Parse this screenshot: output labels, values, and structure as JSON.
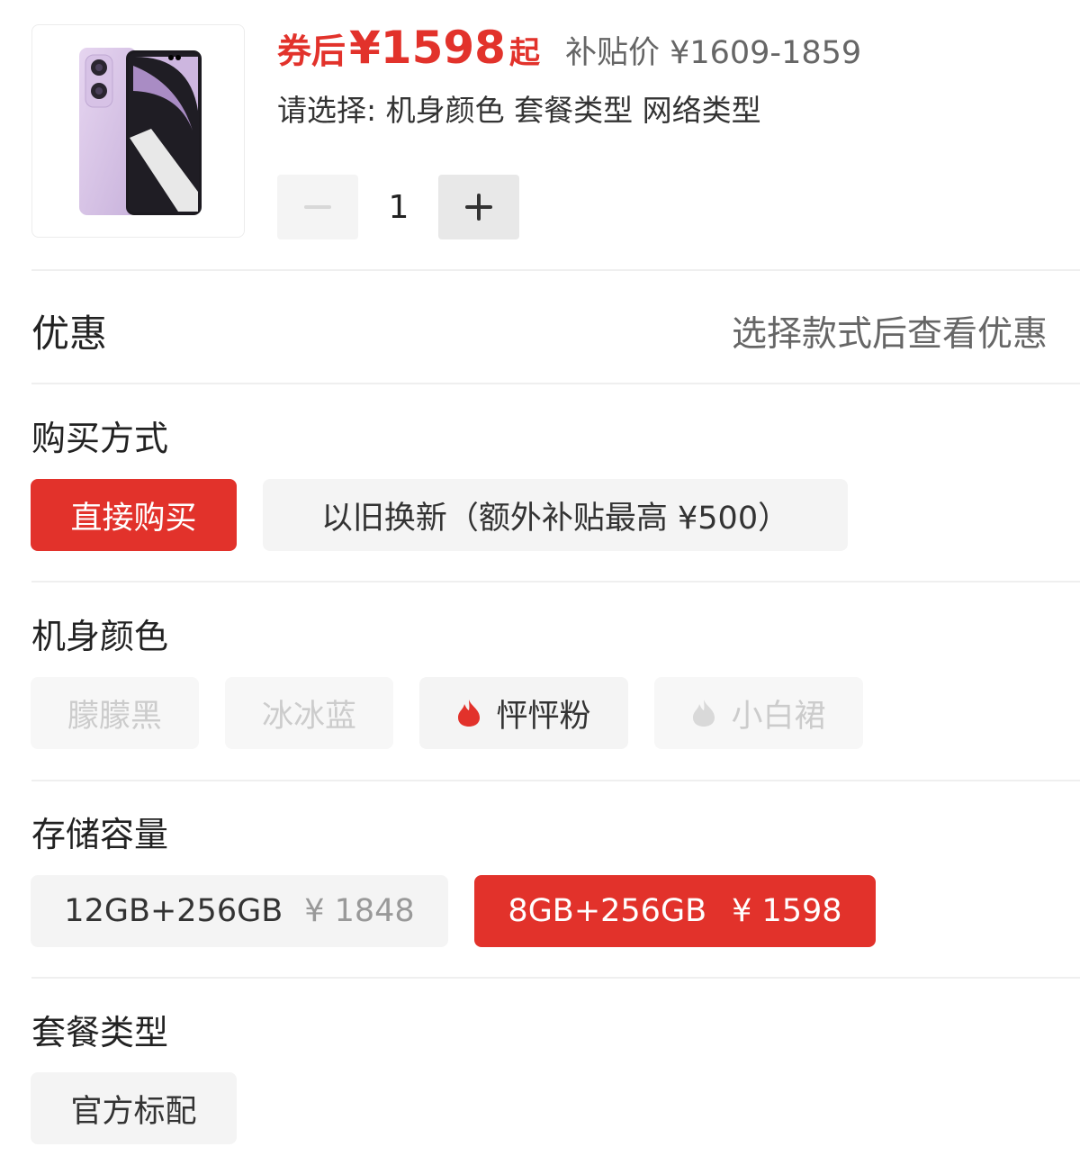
{
  "product": {
    "image_icon": "phone-product-image",
    "coupon_prefix": "券后",
    "coupon_price": "¥1598",
    "coupon_suffix": "起",
    "subsidy_price": "补贴价 ¥1609-1859",
    "select_hint": "请选择: 机身颜色 套餐类型 网络类型",
    "quantity": "1"
  },
  "promo": {
    "label": "优惠",
    "hint": "选择款式后查看优惠"
  },
  "purchase": {
    "title": "购买方式",
    "options": [
      {
        "label": "直接购买",
        "state": "selected"
      },
      {
        "label": "以旧换新（额外补贴最高 ¥500）",
        "state": "normal"
      }
    ]
  },
  "color": {
    "title": "机身颜色",
    "options": [
      {
        "label": "朦朦黑",
        "state": "disabled"
      },
      {
        "label": "冰冰蓝",
        "state": "disabled"
      },
      {
        "label": "怦怦粉",
        "state": "normal",
        "icon": "fire-icon"
      },
      {
        "label": "小白裙",
        "state": "disabled",
        "icon": "fire-icon"
      }
    ]
  },
  "storage": {
    "title": "存储容量",
    "options": [
      {
        "label": "12GB+256GB",
        "price": "¥ 1848",
        "state": "normal"
      },
      {
        "label": "8GB+256GB",
        "price": "¥ 1598",
        "state": "selected"
      }
    ]
  },
  "package": {
    "title": "套餐类型",
    "options": [
      {
        "label": "官方标配",
        "state": "normal"
      }
    ]
  },
  "colors": {
    "accent": "#e2322b",
    "chip_bg": "#f4f4f4",
    "disabled_text": "#cccccc"
  }
}
